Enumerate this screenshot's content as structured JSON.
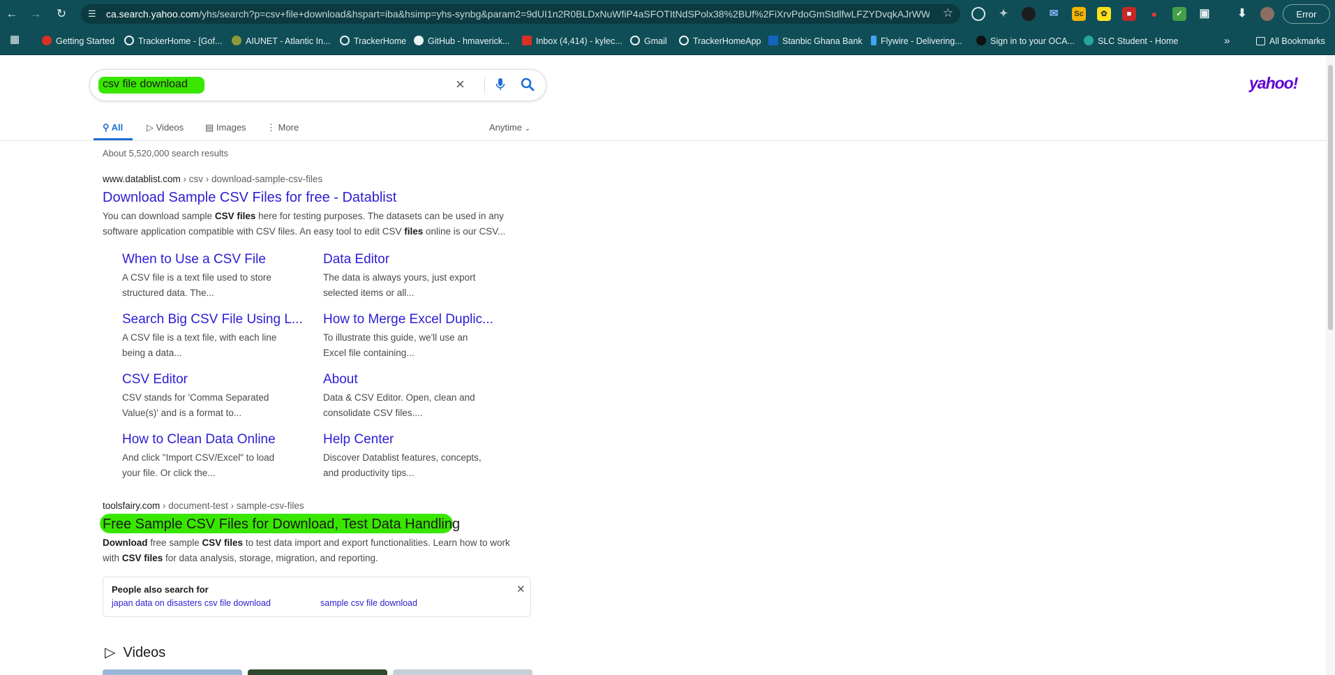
{
  "browser": {
    "url_host": "ca.search.yahoo.com",
    "url_rest": "/yhs/search?p=csv+file+download&hspart=iba&hsimp=yhs-synbg&param2=9dUI1n2R0BLDxNuWfiP4aSFOTItNdSPolx38%2BUf%2FiXrvPdoGmStdlfwLFZYDvqkAJrWWk...",
    "error_label": "Error",
    "extension_labels": [
      "Sc"
    ]
  },
  "bookmarks": [
    {
      "label": "Getting Started"
    },
    {
      "label": "TrackerHome - [Gof..."
    },
    {
      "label": "AIUNET - Atlantic In..."
    },
    {
      "label": "TrackerHome"
    },
    {
      "label": "GitHub - hmaverick..."
    },
    {
      "label": "Inbox (4,414) - kylec..."
    },
    {
      "label": "Gmail"
    },
    {
      "label": "TrackerHomeApp"
    },
    {
      "label": "Stanbic Ghana Bank"
    },
    {
      "label": "Flywire - Delivering..."
    },
    {
      "label": "Sign in to your OCA..."
    },
    {
      "label": "SLC Student - Home"
    }
  ],
  "all_bookmarks_label": "All Bookmarks",
  "search": {
    "query": "csv file download",
    "logo": "yahoo!",
    "tabs": [
      "All",
      "Videos",
      "Images",
      "More"
    ],
    "time_filter": "Anytime",
    "result_count": "About 5,520,000 search results"
  },
  "results": [
    {
      "domain": "www.datablist.com",
      "path": " › csv › download-sample-csv-files",
      "title": "Download Sample CSV Files for free - Datablist",
      "snippet_line1_a": "You can download sample ",
      "snippet_line1_b": "CSV files",
      "snippet_line1_c": " here for testing purposes. The datasets can be used in any",
      "snippet_line2_a": "software application compatible with CSV files. An easy tool to edit CSV ",
      "snippet_line2_b": "files",
      "snippet_line2_c": " online is our CSV...",
      "sitelinks": [
        {
          "title": "When to Use a CSV File",
          "snippet": "A CSV file is a text file used to store structured data. The..."
        },
        {
          "title": "Data Editor",
          "snippet": "The data is always yours, just export selected items or all..."
        },
        {
          "title": "Search Big CSV File Using L...",
          "snippet": "A CSV file is a text file, with each line being a data..."
        },
        {
          "title": "How to Merge Excel Duplic...",
          "snippet": "To illustrate this guide, we'll use an Excel file containing..."
        },
        {
          "title": "CSV Editor",
          "snippet": "CSV stands for 'Comma Separated Value(s)' and is a format to..."
        },
        {
          "title": "About",
          "snippet": "Data & CSV Editor. Open, clean and consolidate CSV files...."
        },
        {
          "title": "How to Clean Data Online",
          "snippet": "And click \"Import CSV/Excel\" to load your file. Or click the..."
        },
        {
          "title": "Help Center",
          "snippet": "Discover Datablist features, concepts, and productivity tips..."
        }
      ]
    },
    {
      "domain": "toolsfairy.com",
      "path": " › document-test › sample-csv-files",
      "title": "Free Sample CSV Files for Download, Test Data Handling",
      "snippet_line1_a": "Download",
      "snippet_line1_b": " free sample ",
      "snippet_line1_c": "CSV files",
      "snippet_line1_d": " to test data import and export functionalities. Learn how to work",
      "snippet_line2_a": "with ",
      "snippet_line2_b": "CSV files",
      "snippet_line2_c": " for data analysis, storage, migration, and reporting."
    }
  ],
  "people_also_search": {
    "heading": "People also search for",
    "links": [
      "japan data on disasters csv file download",
      "sample csv file download"
    ]
  },
  "videos_heading": "Videos",
  "colors": {
    "accent": "#1f6fd6",
    "link": "#2d1dd2",
    "highlight": "#39e600",
    "chrome": "#0f4e56",
    "yahoo": "#6001d2"
  }
}
